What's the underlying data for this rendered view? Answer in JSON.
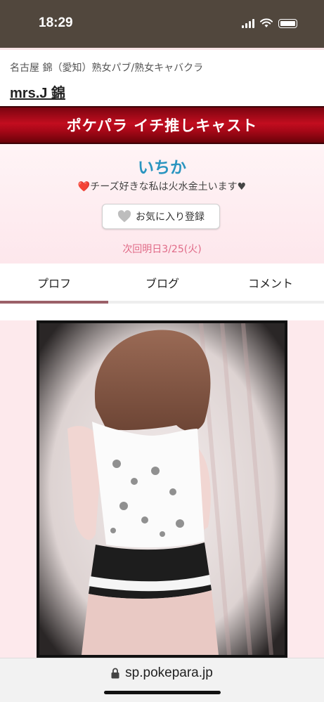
{
  "status_bar": {
    "time": "18:29"
  },
  "shop": {
    "category": "名古屋 錦（愛知）熟女パブ/熟女キャバクラ",
    "name": "mrs.J 錦"
  },
  "banner": {
    "title": "ポケパラ イチ推しキャスト"
  },
  "cast": {
    "name": "いちか",
    "catchphrase": "❤️チーズ好きな私は火水金土います♥",
    "favorite_button": "お気に入り登録",
    "next_date": "次回明日3/25(火)"
  },
  "tabs": [
    {
      "label": "プロフ",
      "active": true
    },
    {
      "label": "ブログ",
      "active": false
    },
    {
      "label": "コメント",
      "active": false
    }
  ],
  "browser": {
    "url": "sp.pokepara.jp"
  },
  "colors": {
    "status_bar": "#51473d",
    "banner_red": "#c20d1f",
    "cast_name": "#2a95c0",
    "next_date": "#e06a87",
    "tab_active": "#9b6068",
    "section_bg": "#fde9ec"
  },
  "icons": [
    "signal-icon",
    "wifi-icon",
    "battery-icon",
    "heart-icon",
    "lock-icon"
  ]
}
